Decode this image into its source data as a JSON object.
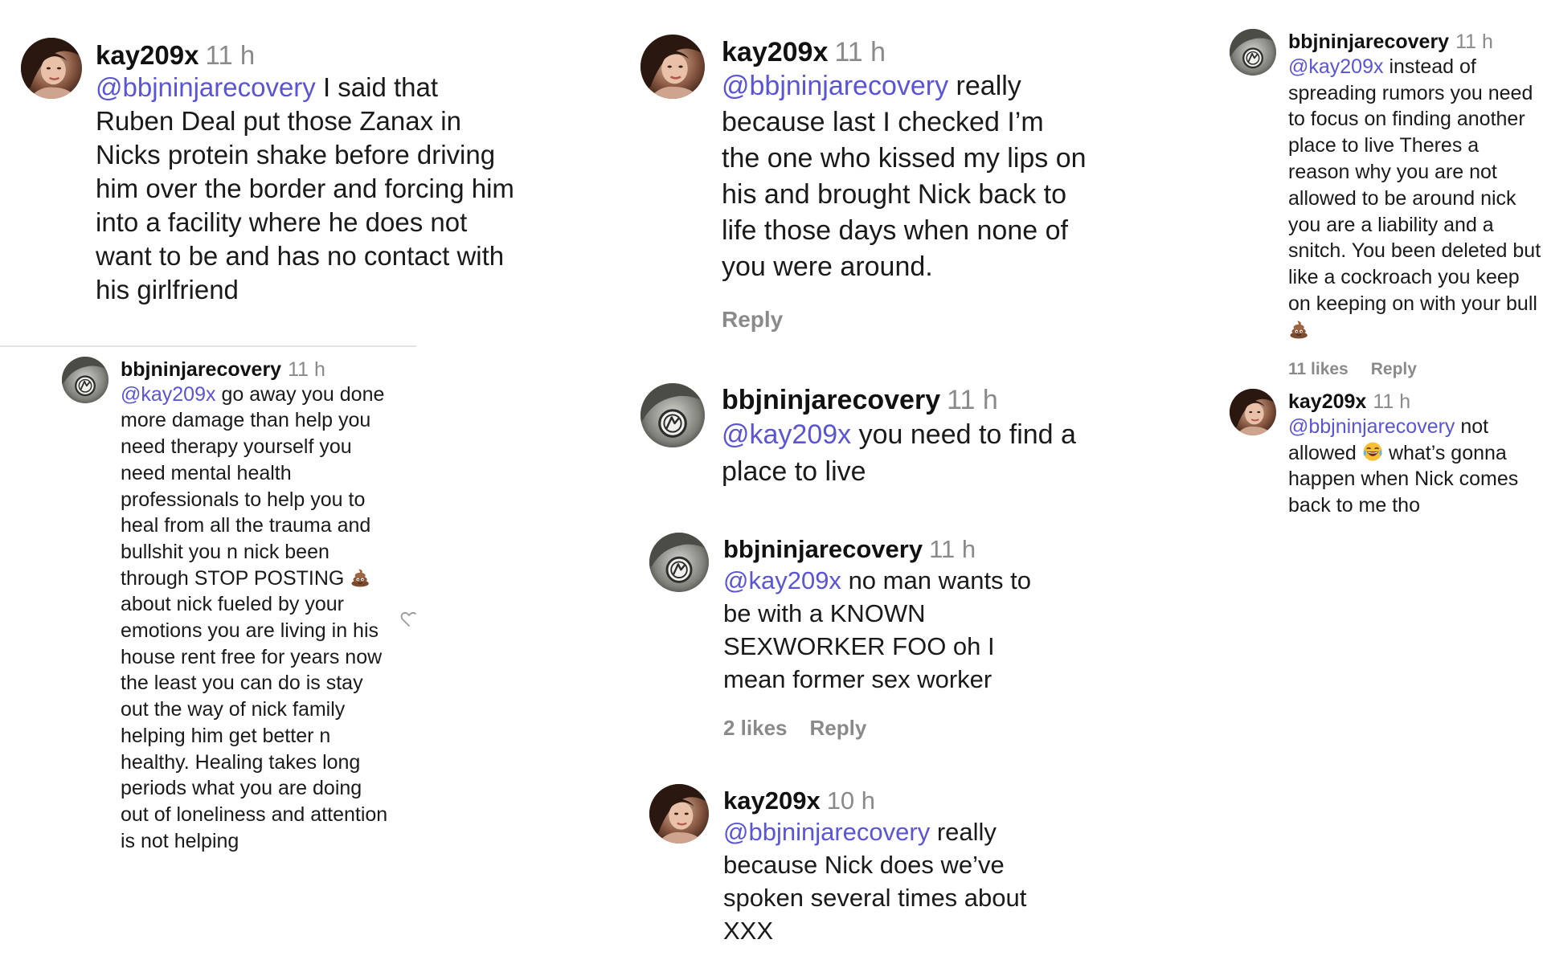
{
  "comments": [
    {
      "username": "kay209x",
      "time": "11 h",
      "mention": "@bbjninjarecovery",
      "text": "I said that Ruben Deal put those Zanax in Nicks protein shake before driving him over the border and forcing him into a facility where he does not want to be and has no contact with his girlfriend",
      "avatar": "female-avatar"
    },
    {
      "username": "bbjninjarecovery",
      "time": "11 h",
      "mention": "@kay209x",
      "text_before_emoji": "go away you done more damage than help you need therapy yourself you need mental health professionals to help you to heal from all the trauma and bullshit you n nick been through STOP POSTING",
      "emoji": "poop-emoji",
      "text_after_emoji": "about nick fueled by your emotions you are living in his house rent free for years now the least you can do is stay out the way of nick family helping him get better n healthy. Healing takes long periods what you are doing out of loneliness and attention is not helping",
      "avatar": "logo-avatar"
    },
    {
      "username": "kay209x",
      "time": "11 h",
      "mention": "@bbjninjarecovery",
      "text": "really because last I checked I’m the one who kissed my lips on his and brought Nick back to life those days when none of you were around.",
      "reply_label": "Reply",
      "avatar": "female-avatar"
    },
    {
      "username": "bbjninjarecovery",
      "time": "11 h",
      "mention": "@kay209x",
      "text": "you need to find a place to live",
      "avatar": "logo-avatar"
    },
    {
      "username": "bbjninjarecovery",
      "time": "11 h",
      "mention": "@kay209x",
      "text": "no man wants to be with a KNOWN SEXWORKER FOO oh I mean former sex worker",
      "likes": "2 likes",
      "reply_label": "Reply",
      "avatar": "logo-avatar"
    },
    {
      "username": "kay209x",
      "time": "10 h",
      "mention": "@bbjninjarecovery",
      "text": "really because Nick does we’ve spoken several times about XXX",
      "avatar": "female-avatar"
    },
    {
      "username": "bbjninjarecovery",
      "time": "11 h",
      "mention": "@kay209x",
      "text": "instead of spreading rumors you need to focus on finding another place to live Theres a reason why you are not allowed to be around nick you are a liability and a snitch. You been deleted but like a cockroach you keep on keeping on with your bull",
      "emoji": "poop-emoji",
      "likes": "11 likes",
      "reply_label": "Reply",
      "avatar": "logo-avatar"
    },
    {
      "username": "kay209x",
      "time": "11 h",
      "mention": "@bbjninjarecovery",
      "text_before_emoji": "not allowed",
      "emoji": "laughing-emoji",
      "text_after_emoji": "what’s gonna happen when Nick comes back to me tho",
      "avatar": "female-avatar"
    }
  ],
  "colors": {
    "mention": "#5a54d6",
    "meta": "#8a8a8a",
    "divider": "#e3e3e3"
  }
}
